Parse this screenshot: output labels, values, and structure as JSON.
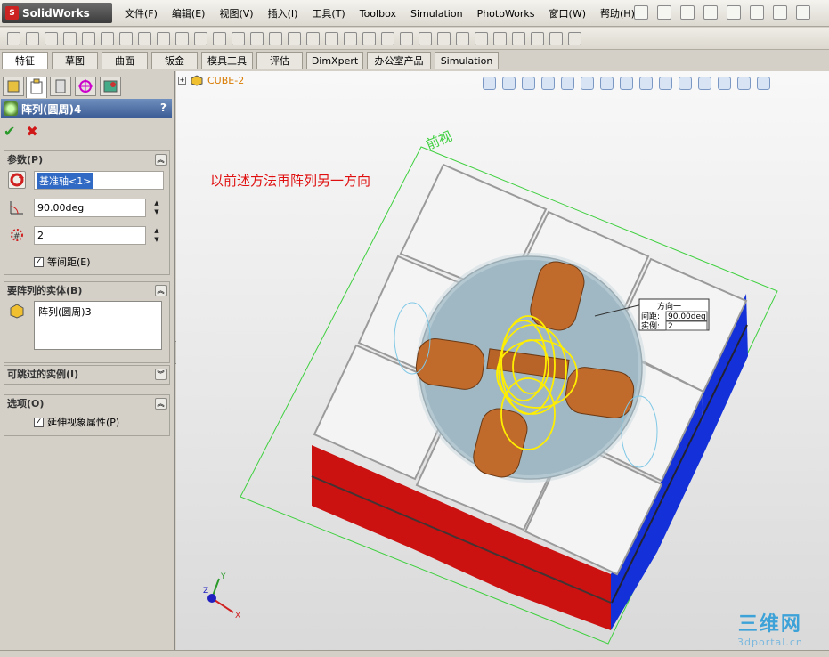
{
  "app": {
    "logo_text": "SolidWorks"
  },
  "menu": {
    "items": [
      "文件(F)",
      "编辑(E)",
      "视图(V)",
      "插入(I)",
      "工具(T)",
      "Toolbox",
      "Simulation",
      "PhotoWorks",
      "窗口(W)",
      "帮助(H)"
    ]
  },
  "command_tabs": [
    "特征",
    "草图",
    "曲面",
    "钣金",
    "模具工具",
    "评估",
    "DimXpert",
    "办公室产品",
    "Simulation"
  ],
  "property_manager": {
    "title": "阵列(圆周)4",
    "help": "?",
    "ok_symbol": "✔",
    "cancel_symbol": "✖",
    "params_group": {
      "title": "参数(P)",
      "axis_value": "基准轴<1>",
      "angle_value": "90.00deg",
      "instances_value": "2",
      "equal_spacing_label": "等间距(E)"
    },
    "bodies_group": {
      "title": "要阵列的实体(B)",
      "items": [
        "阵列(圆周)3"
      ]
    },
    "skip_group": {
      "title": "可跳过的实例(I)"
    },
    "options_group": {
      "title": "选项(O)",
      "propagate_label": "延伸视象属性(P)"
    }
  },
  "graphics": {
    "tree_item": "CUBE-2",
    "annotation": "以前述方法再阵列另一方向",
    "view_label": "前视",
    "callout": {
      "title": "方向一",
      "spacing_label": "间距:",
      "spacing_value": "90.00deg",
      "instances_label": "实例:",
      "instances_value": "2"
    },
    "triad": {
      "x": "X",
      "y": "Y",
      "z": "Z"
    }
  },
  "watermark": {
    "big": "三维网",
    "small": "3dportal.cn"
  },
  "colors": {
    "red_face": "#c11",
    "blue_face": "#1430d8",
    "white_face": "#f4f4f4",
    "copper": "#c06a2c",
    "preview": "#ffee00",
    "plane": "#33cc33"
  }
}
